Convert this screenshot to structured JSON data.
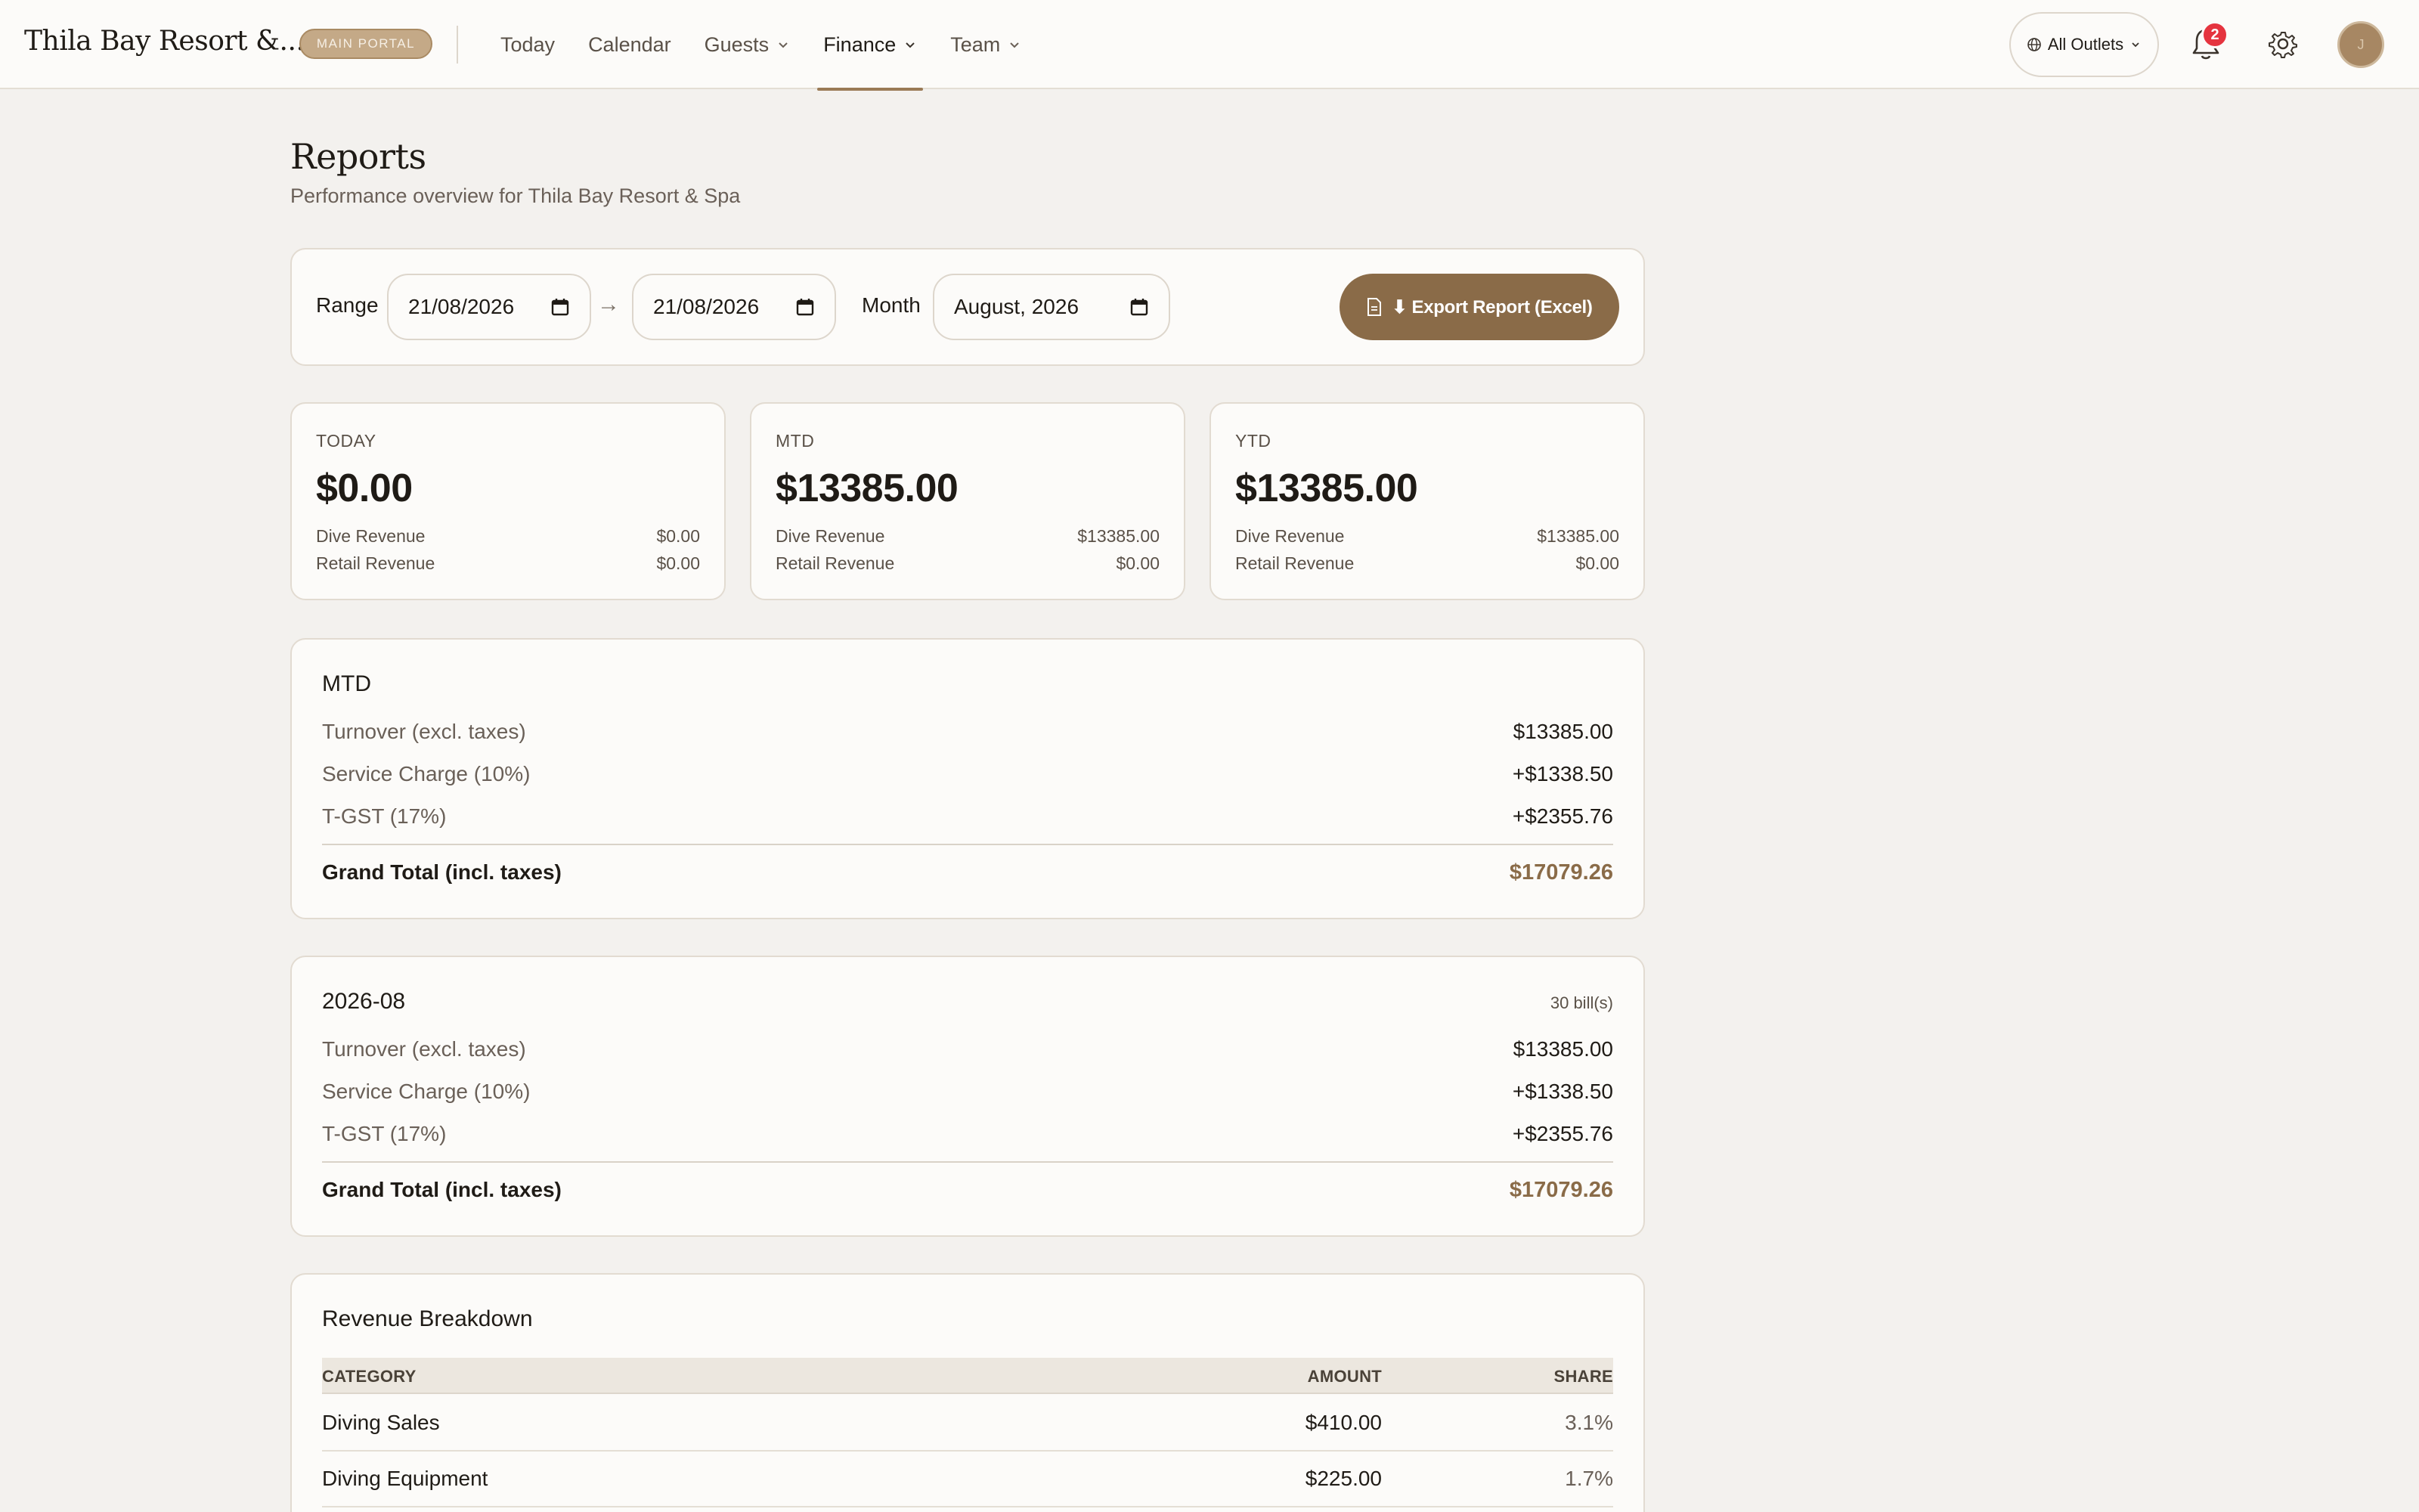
{
  "topbar": {
    "brand": "Thila Bay Resort &...",
    "portal_badge": "MAIN PORTAL",
    "nav": [
      {
        "label": "Today",
        "has_menu": false
      },
      {
        "label": "Calendar",
        "has_menu": false
      },
      {
        "label": "Guests",
        "has_menu": true
      },
      {
        "label": "Finance",
        "has_menu": true,
        "active": true
      },
      {
        "label": "Team",
        "has_menu": true
      }
    ],
    "outlets_label": "All Outlets",
    "notification_count": "2",
    "avatar_initial": "J"
  },
  "page": {
    "title": "Reports",
    "subtitle": "Performance overview for Thila Bay Resort & Spa"
  },
  "filters": {
    "range_label": "Range",
    "range_from": "21/08/2026",
    "range_arrow": "→",
    "range_to": "21/08/2026",
    "month_label": "Month",
    "month_value": "August, 2026",
    "export_label": "⬇ Export Report (Excel)"
  },
  "kpis": [
    {
      "label": "TODAY",
      "value": "$0.00",
      "rows": [
        {
          "label": "Dive Revenue",
          "value": "$0.00"
        },
        {
          "label": "Retail Revenue",
          "value": "$0.00"
        }
      ]
    },
    {
      "label": "MTD",
      "value": "$13385.00",
      "rows": [
        {
          "label": "Dive Revenue",
          "value": "$13385.00"
        },
        {
          "label": "Retail Revenue",
          "value": "$0.00"
        }
      ]
    },
    {
      "label": "YTD",
      "value": "$13385.00",
      "rows": [
        {
          "label": "Dive Revenue",
          "value": "$13385.00"
        },
        {
          "label": "Retail Revenue",
          "value": "$0.00"
        }
      ]
    }
  ],
  "summaries": [
    {
      "title": "MTD",
      "meta": "",
      "rows": [
        {
          "label": "Turnover (excl. taxes)",
          "value": "$13385.00"
        },
        {
          "label": "Service Charge (10%)",
          "value": "+$1338.50"
        },
        {
          "label": "T-GST (17%)",
          "value": "+$2355.76"
        }
      ],
      "total_label": "Grand Total (incl. taxes)",
      "total_value": "$17079.26"
    },
    {
      "title": "2026-08",
      "meta": "30 bill(s)",
      "rows": [
        {
          "label": "Turnover (excl. taxes)",
          "value": "$13385.00"
        },
        {
          "label": "Service Charge (10%)",
          "value": "+$1338.50"
        },
        {
          "label": "T-GST (17%)",
          "value": "+$2355.76"
        }
      ],
      "total_label": "Grand Total (incl. taxes)",
      "total_value": "$17079.26"
    }
  ],
  "revenue": {
    "title": "Revenue Breakdown",
    "headers": {
      "category": "CATEGORY",
      "amount": "AMOUNT",
      "share": "SHARE"
    },
    "rows": [
      {
        "category": "Diving Sales",
        "amount": "$410.00",
        "share": "3.1%"
      },
      {
        "category": "Diving Equipment",
        "amount": "$225.00",
        "share": "1.7%"
      }
    ]
  },
  "colors": {
    "accent": "#8a6b48",
    "background": "#f3f1ee",
    "card": "#fcfbf9",
    "badge": "#e5343f"
  }
}
